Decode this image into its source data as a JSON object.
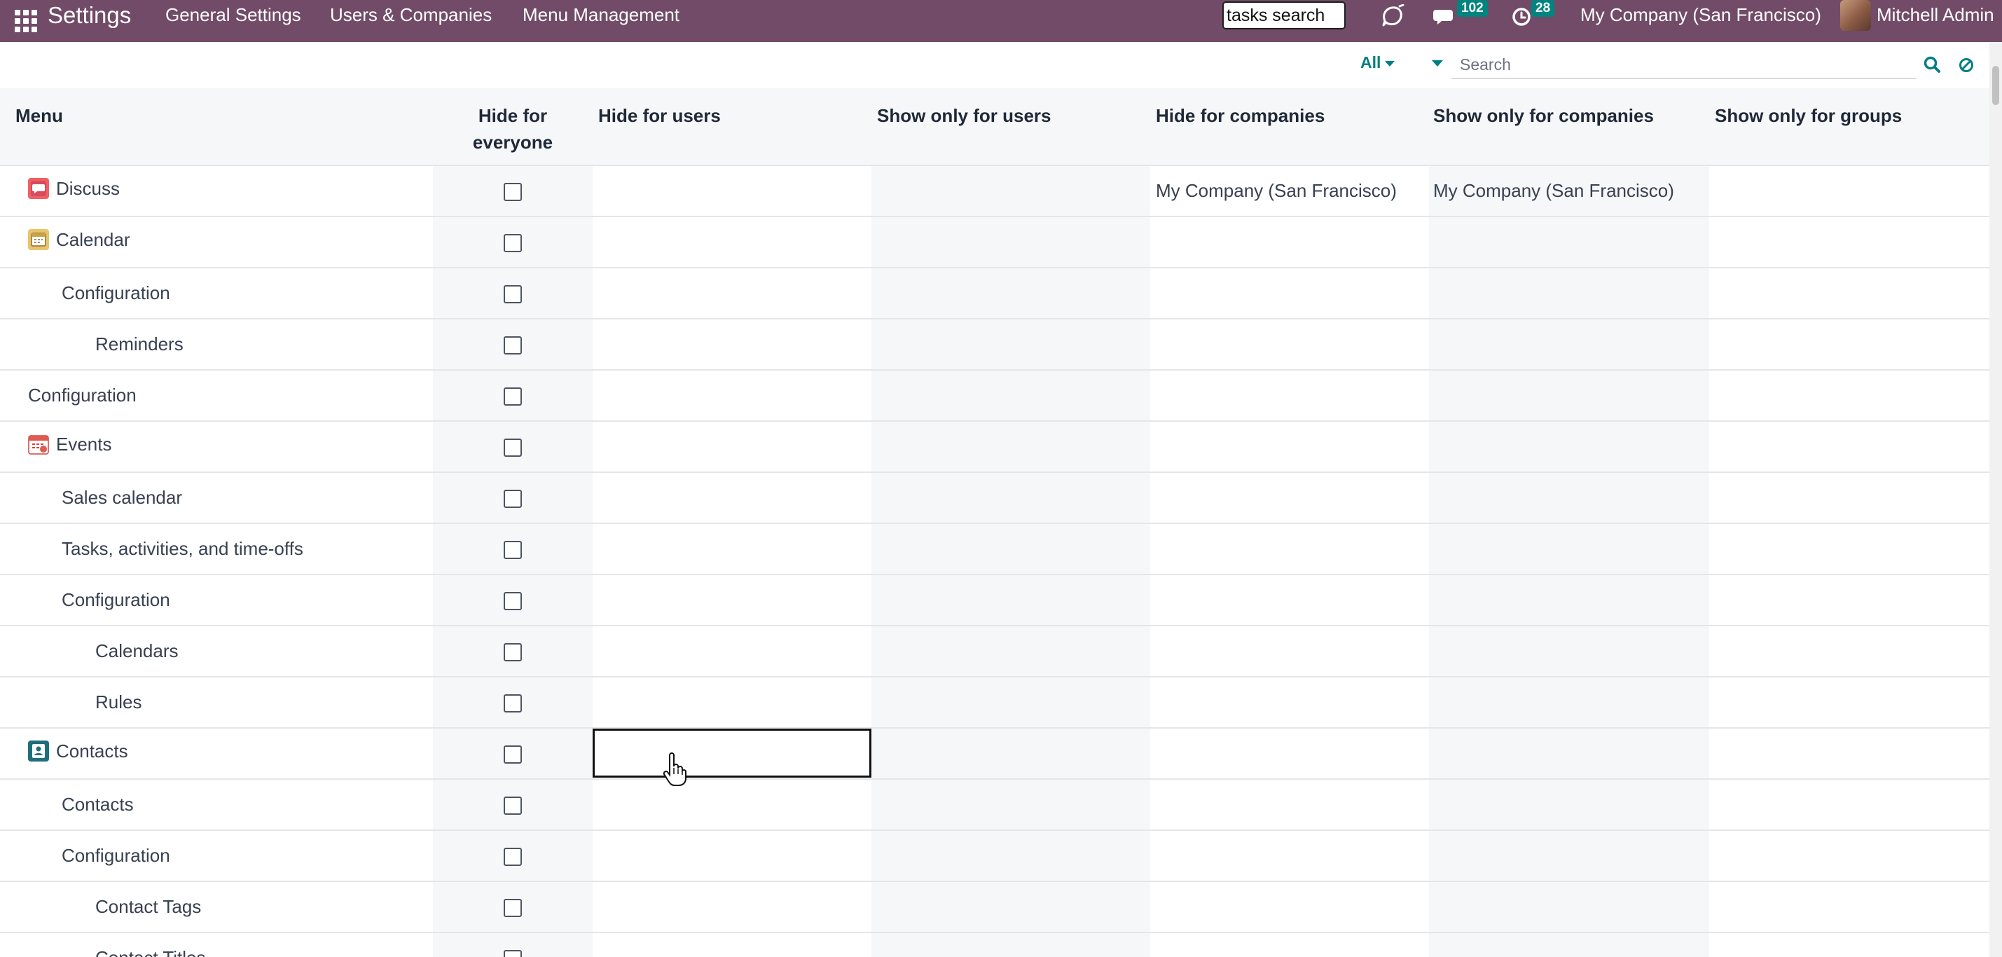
{
  "navbar": {
    "app_name": "Settings",
    "menu_items": [
      "General Settings",
      "Users & Companies",
      "Menu Management"
    ],
    "tasks_search_value": "tasks search",
    "messages_count": "102",
    "activities_count": "28",
    "company": "My Company (San Francisco)",
    "user": "Mitchell Admin",
    "color": "#714B67"
  },
  "search": {
    "filter_label": "All",
    "placeholder": "Search"
  },
  "table": {
    "headers": {
      "menu": "Menu",
      "hide_everyone_line1": "Hide for",
      "hide_everyone_line2": "everyone",
      "hide_users": "Hide for users",
      "show_users": "Show only for users",
      "hide_companies": "Hide for companies",
      "show_companies": "Show only for companies",
      "show_groups": "Show only for groups"
    },
    "rows": [
      {
        "name": "Discuss",
        "level": 0,
        "icon": "discuss-icon",
        "hide_companies": "My Company (San Francisco)",
        "show_companies": "My Company (San Francisco)"
      },
      {
        "name": "Calendar",
        "level": 0,
        "icon": "calendar-icon",
        "hide_companies": "",
        "show_companies": ""
      },
      {
        "name": "Configuration",
        "level": 1,
        "icon": "",
        "hide_companies": "",
        "show_companies": ""
      },
      {
        "name": "Reminders",
        "level": 2,
        "icon": "",
        "hide_companies": "",
        "show_companies": ""
      },
      {
        "name": "Configuration",
        "level": 0,
        "icon": "",
        "hide_companies": "",
        "show_companies": ""
      },
      {
        "name": "Events",
        "level": 0,
        "icon": "events-icon",
        "hide_companies": "",
        "show_companies": ""
      },
      {
        "name": "Sales calendar",
        "level": 1,
        "icon": "",
        "hide_companies": "",
        "show_companies": ""
      },
      {
        "name": "Tasks, activities, and time-offs",
        "level": 1,
        "icon": "",
        "hide_companies": "",
        "show_companies": ""
      },
      {
        "name": "Configuration",
        "level": 1,
        "icon": "",
        "hide_companies": "",
        "show_companies": ""
      },
      {
        "name": "Calendars",
        "level": 2,
        "icon": "",
        "hide_companies": "",
        "show_companies": ""
      },
      {
        "name": "Rules",
        "level": 2,
        "icon": "",
        "hide_companies": "",
        "show_companies": ""
      },
      {
        "name": "Contacts",
        "level": 0,
        "icon": "contacts-icon",
        "hide_companies": "",
        "show_companies": ""
      },
      {
        "name": "Contacts",
        "level": 1,
        "icon": "",
        "hide_companies": "",
        "show_companies": ""
      },
      {
        "name": "Configuration",
        "level": 1,
        "icon": "",
        "hide_companies": "",
        "show_companies": ""
      },
      {
        "name": "Contact Tags",
        "level": 2,
        "icon": "",
        "hide_companies": "",
        "show_companies": ""
      },
      {
        "name": "Contact Titles",
        "level": 2,
        "icon": "",
        "hide_companies": "",
        "show_companies": ""
      }
    ]
  }
}
